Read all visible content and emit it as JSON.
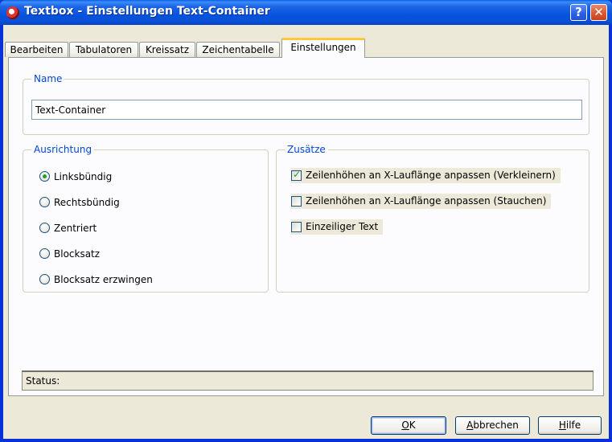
{
  "window": {
    "title": "Textbox - Einstellungen Text-Container",
    "help_glyph": "?",
    "close_glyph": "✕"
  },
  "tabs": [
    {
      "label": "Bearbeiten",
      "active": false
    },
    {
      "label": "Tabulatoren",
      "active": false
    },
    {
      "label": "Kreissatz",
      "active": false
    },
    {
      "label": "Zeichentabelle",
      "active": false
    },
    {
      "label": "Einstellungen",
      "active": true
    }
  ],
  "name_group": {
    "legend": "Name",
    "value": "Text-Container"
  },
  "alignment_group": {
    "legend": "Ausrichtung",
    "options": [
      {
        "label": "Linksbündig",
        "selected": true
      },
      {
        "label": "Rechtsbündig",
        "selected": false
      },
      {
        "label": "Zentriert",
        "selected": false
      },
      {
        "label": "Blocksatz",
        "selected": false
      },
      {
        "label": "Blocksatz erzwingen",
        "selected": false
      }
    ]
  },
  "extras_group": {
    "legend": "Zusätze",
    "options": [
      {
        "label": "Zeilenhöhen an X-Lauflänge anpassen (Verkleinern)",
        "checked": true
      },
      {
        "label": "Zeilenhöhen an X-Lauflänge anpassen (Stauchen)",
        "checked": false
      },
      {
        "label": "Einzeiliger Text",
        "checked": false
      }
    ]
  },
  "status": {
    "label": "Status:"
  },
  "buttons": {
    "ok": {
      "mnemonic": "O",
      "rest": "K"
    },
    "cancel": {
      "mnemonic": "A",
      "rest": "bbrechen"
    },
    "help": {
      "mnemonic": "H",
      "rest": "ilfe"
    }
  },
  "colors": {
    "title_bar": "#0a5fe8",
    "dialog_bg": "#ece9d8",
    "legend_text": "#0046d5",
    "active_tab_accent": "#ffc83c"
  }
}
